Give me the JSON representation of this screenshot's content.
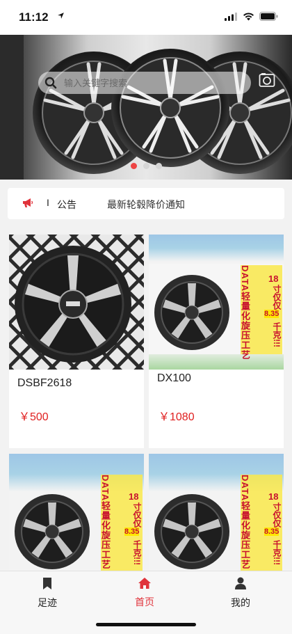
{
  "status": {
    "time": "11:12"
  },
  "search": {
    "placeholder": "输入关键字搜索"
  },
  "notice": {
    "title": "公告",
    "separator": "I",
    "text": "最新轮毂降价通知"
  },
  "products": [
    {
      "name": "DSBF2618",
      "price": "￥500"
    },
    {
      "name": "DX100",
      "price": "￥1080"
    },
    {
      "name": "",
      "price": ""
    },
    {
      "name": "",
      "price": ""
    }
  ],
  "banner_text": {
    "vertical": "DATA轻量化旋压工艺",
    "badge_num": "18",
    "badge_inch": "寸仅仅",
    "badge_weight": "8.35",
    "badge_unit": "千克!!!"
  },
  "tabs": [
    {
      "label": "足迹",
      "icon": "bookmark-icon",
      "active": false
    },
    {
      "label": "首页",
      "icon": "home-icon",
      "active": true
    },
    {
      "label": "我的",
      "icon": "person-icon",
      "active": false
    }
  ],
  "colors": {
    "accent": "#e0333b",
    "price": "#e02020"
  }
}
